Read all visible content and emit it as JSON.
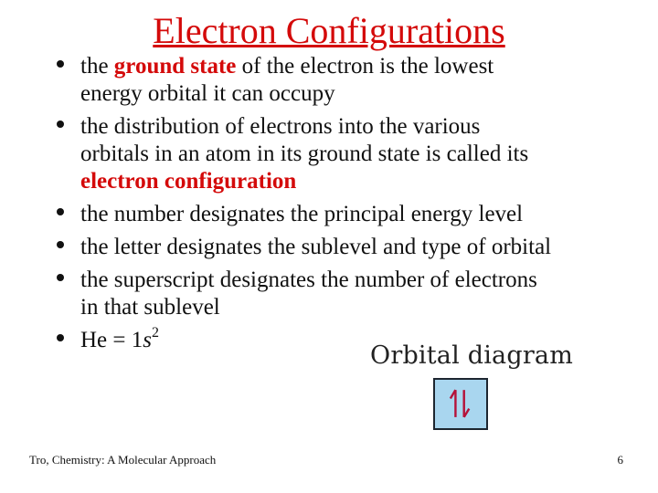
{
  "slide": {
    "title": "Electron Configurations",
    "bullets": [
      {
        "lines": [
          {
            "pre": "the ",
            "highlight": "ground state",
            "post": " of the electron is the lowest"
          },
          {
            "text": "energy orbital it can occupy"
          }
        ]
      },
      {
        "lines": [
          {
            "text": "the distribution of electrons into the various"
          },
          {
            "text": "orbitals in an atom in its ground state is called its"
          },
          {
            "highlight": "electron configuration"
          }
        ]
      },
      {
        "lines": [
          {
            "text": "the number designates the principal energy level"
          }
        ]
      },
      {
        "lines": [
          {
            "text": "the letter designates the sublevel and type of orbital"
          }
        ]
      },
      {
        "lines": [
          {
            "text": "the superscript designates the number of electrons"
          },
          {
            "text": "in that sublevel"
          }
        ]
      },
      {
        "formula": {
          "element": "He = 1",
          "orbital": "s",
          "superscript": "2"
        }
      }
    ],
    "highlight_color": "#d40a0a"
  },
  "orbital_diagram": {
    "label": "Orbital diagram",
    "electrons": [
      "spin-up",
      "spin-down"
    ],
    "box_color": "#a9d6ef",
    "arrow_color": "#b5123a"
  },
  "footer": {
    "source": "Tro, Chemistry: A Molecular Approach",
    "page_number": "6"
  }
}
